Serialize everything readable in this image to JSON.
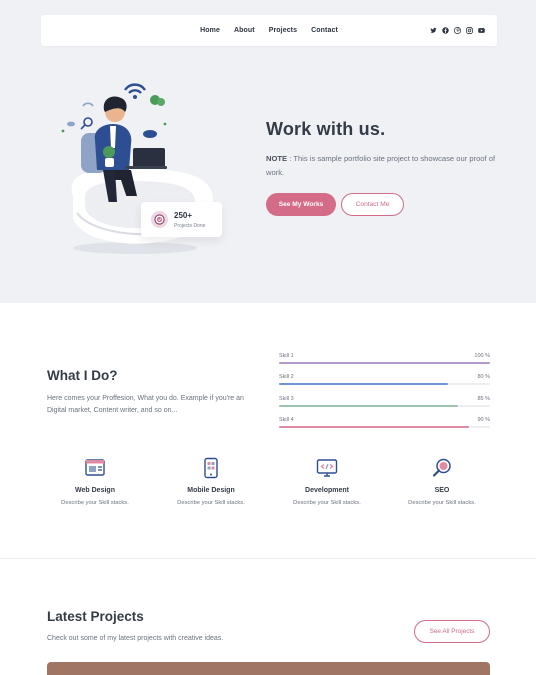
{
  "nav": {
    "links": [
      "Home",
      "About",
      "Projects",
      "Contact"
    ],
    "socials": [
      "twitter-icon",
      "facebook-icon",
      "pinterest-icon",
      "instagram-icon",
      "youtube-icon"
    ]
  },
  "hero": {
    "title": "Work with us.",
    "note_label": "NOTE",
    "note_text": ": This is sample portfolio site project to showcase our proof of work.",
    "primary_button": "See My Works",
    "secondary_button": "Contact Me",
    "stat_number": "250+",
    "stat_label": "Projects Done"
  },
  "what_i_do": {
    "title": "What I Do?",
    "description": "Here comes your Proffesion, What you do. Example if you're an Digital market, Content writer, and so on...",
    "skills": [
      {
        "name": "Skill 1",
        "value_label": "100 %",
        "level": 1.0,
        "color": "#b39bc8"
      },
      {
        "name": "Skill 2",
        "value_label": "80 %",
        "level": 0.8,
        "color": "#6f95d4"
      },
      {
        "name": "Skill 3",
        "value_label": "85 %",
        "level": 0.85,
        "color": "#9bc3ad"
      },
      {
        "name": "Skill 4",
        "value_label": "90 %",
        "level": 0.9,
        "color": "#e08aa3"
      }
    ],
    "services": [
      {
        "title": "Web Design",
        "desc": "Describe your Skill stacks.",
        "icon": "web-design-icon"
      },
      {
        "title": "Mobile Design",
        "desc": "Describe your Skill stacks.",
        "icon": "mobile-design-icon"
      },
      {
        "title": "Development",
        "desc": "Describe your Skill stacks.",
        "icon": "development-icon"
      },
      {
        "title": "SEO",
        "desc": "Describe your Skill stacks.",
        "icon": "seo-icon"
      }
    ]
  },
  "latest_projects": {
    "title": "Latest Projects",
    "description": "Check out some of my latest projects with creative ideas.",
    "button": "See All Projects"
  },
  "colors": {
    "accent": "#d46c87",
    "hero_bg": "#eff1f5",
    "project_card": "#a17563"
  }
}
